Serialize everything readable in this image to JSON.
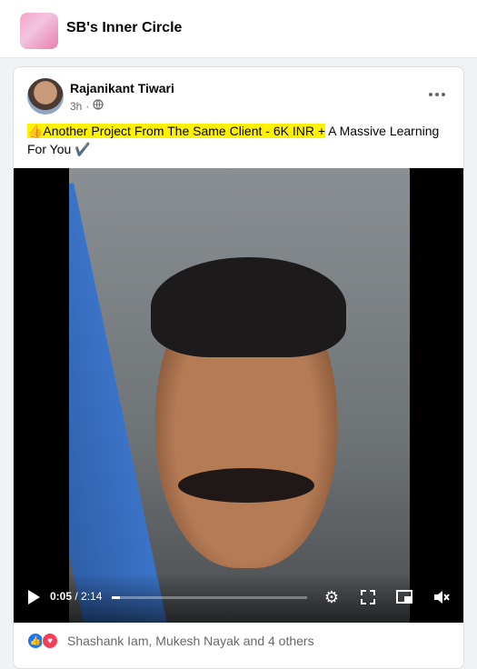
{
  "group": {
    "title": "SB's Inner Circle"
  },
  "post": {
    "author": "Rajanikant Tiwari",
    "time": "3h",
    "privacy_icon": "globe-icon",
    "text_highlight": "👍Another Project From The Same Client - 6K INR +",
    "text_rest": " A Massive Learning For You ✔️",
    "highlight_color": "#fff200"
  },
  "video": {
    "current_time": "0:05",
    "duration": "2:14",
    "progress": 0.04
  },
  "reactions": {
    "icons": [
      "like-icon",
      "love-icon"
    ],
    "summary": "Shashank Iam, Mukesh Nayak and 4 others"
  },
  "colors": {
    "brand_blue": "#1877f2",
    "love_red": "#f33e58"
  }
}
